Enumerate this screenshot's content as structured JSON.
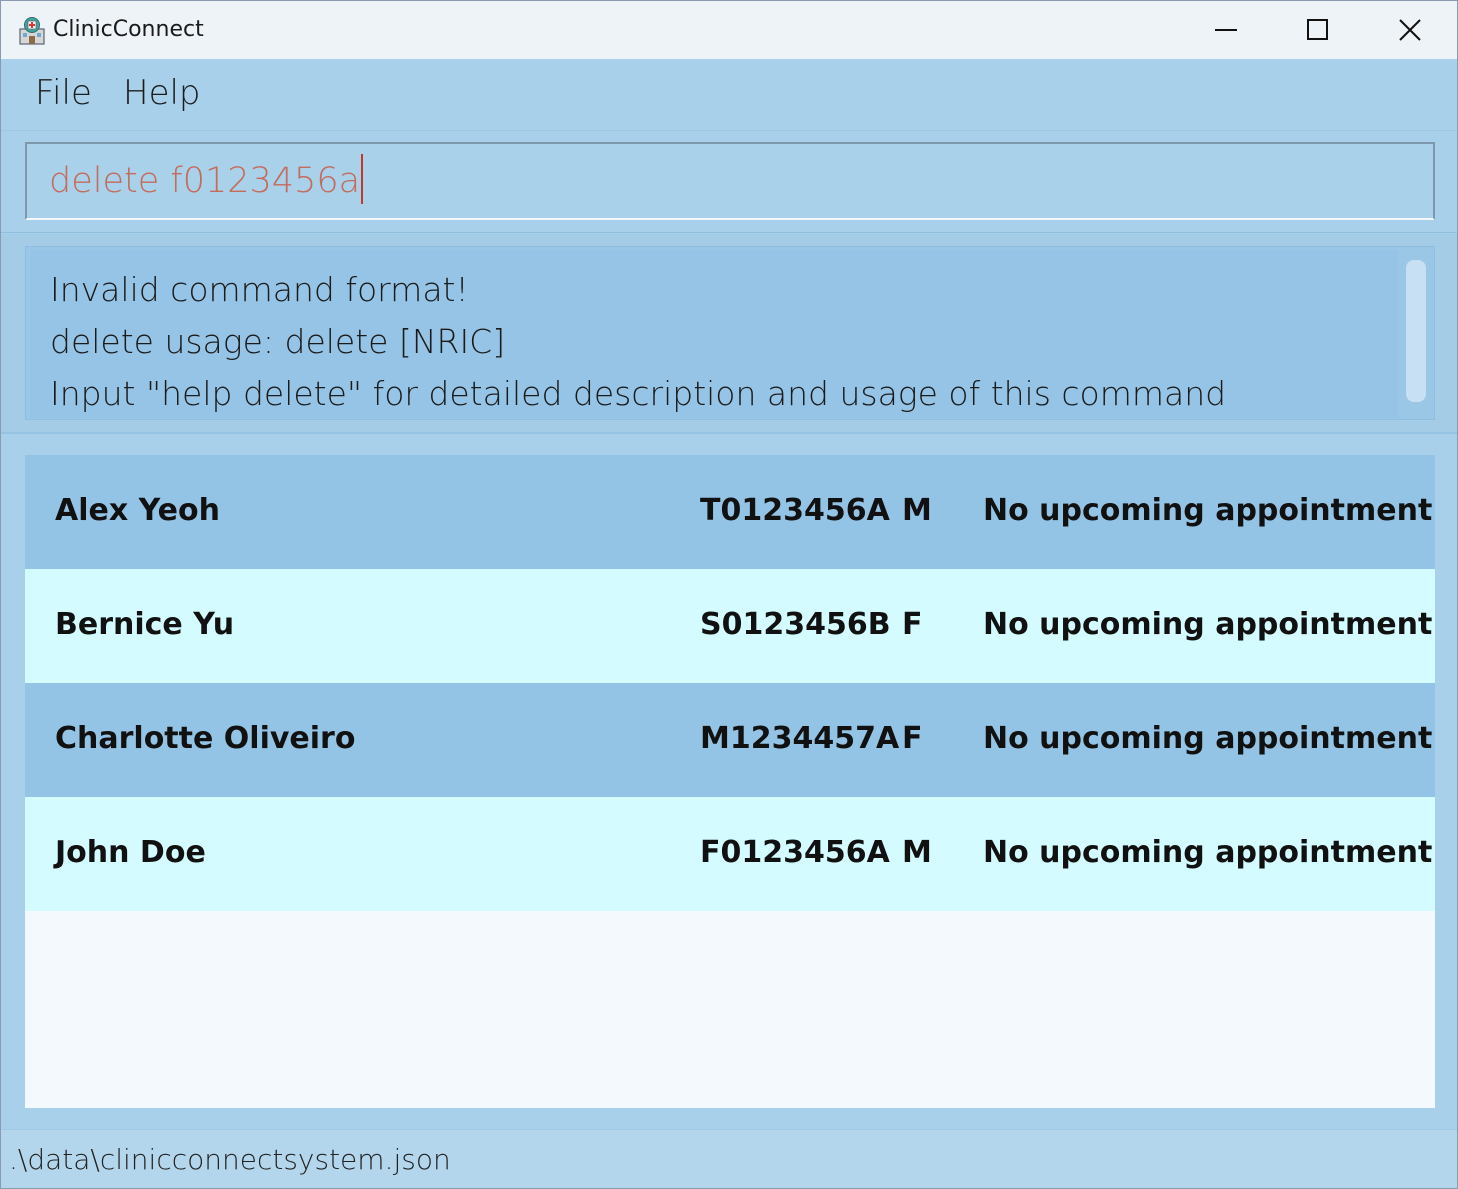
{
  "window": {
    "title": "ClinicConnect"
  },
  "menu": {
    "file_label": "File",
    "help_label": "Help"
  },
  "command": {
    "value": "delete f0123456a"
  },
  "result": {
    "lines": [
      "Invalid command format!",
      "delete usage: delete [NRIC]",
      "Input \"help delete\" for detailed description and usage of this command"
    ]
  },
  "patients": [
    {
      "name": "Alex Yeoh",
      "nric": "T0123456A",
      "sex": "M",
      "appointment": "No upcoming appointment",
      "bg": "#94c4e5"
    },
    {
      "name": "Bernice Yu",
      "nric": "S0123456B",
      "sex": "F",
      "appointment": "No upcoming appointment",
      "bg": "#d4fbff"
    },
    {
      "name": "Charlotte Oliveiro",
      "nric": "M1234457A",
      "sex": "F",
      "appointment": "No upcoming appointment",
      "bg": "#94c4e5"
    },
    {
      "name": "John Doe",
      "nric": "F0123456A",
      "sex": "M",
      "appointment": "No upcoming appointment",
      "bg": "#d4fbff"
    }
  ],
  "status": {
    "path": ".\\data\\clinicconnectsystem.json"
  },
  "colors": {
    "accent": "#a8d0ea",
    "input_text": "#c56b5a"
  }
}
